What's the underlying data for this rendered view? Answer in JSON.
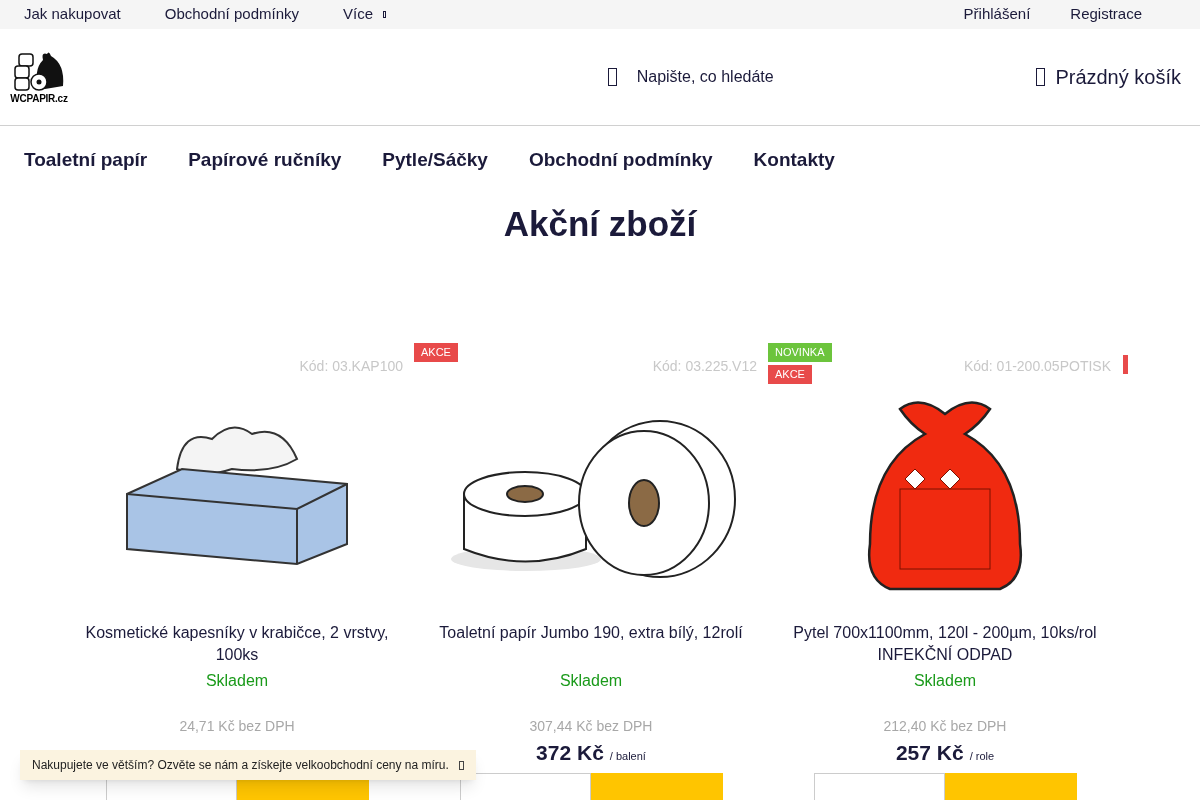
{
  "top_bar": {
    "links": [
      "Jak nakupovat",
      "Obchodní podmínky",
      "Více"
    ],
    "account": [
      "Přihlášení",
      "Registrace"
    ]
  },
  "header": {
    "logo_text": "WCPAPIR.cz",
    "search": {
      "placeholder": "Napište, co hledáte"
    },
    "cart": "Prázdný košík"
  },
  "nav": [
    "Toaletní papír",
    "Papírové ručníky",
    "Pytle/Sáčky",
    "Obchodní podmínky",
    "Kontakty"
  ],
  "heading": "Akční zboží",
  "products": [
    {
      "kind": "tissues",
      "code": "Kód: 03.KAP100",
      "name": "Kosmetické kapesníky v krabičce, 2 vrstvy, 100ks",
      "availability": "Skladem",
      "price_net": "24,71 Kč bez DPH"
    },
    {
      "kind": "rolls",
      "badges": [
        {
          "label": "AKCE",
          "color": "#e84a4a"
        }
      ],
      "code": "Kód: 03.225.V12",
      "name": "Toaletní papír Jumbo 190, extra bílý, 12rolí",
      "availability": "Skladem",
      "price_net": "307,44 Kč bez DPH",
      "price": "372 Kč",
      "unit": "/ balení"
    },
    {
      "kind": "bag",
      "badges": [
        {
          "label": "NOVINKA",
          "color": "#6cc43c"
        },
        {
          "label": "AKCE",
          "color": "#e84a4a"
        }
      ],
      "code": "Kód: 01-200.05POTISK",
      "name": "Pytel 700x1100mm, 120l - 200µm, 10ks/rol INFEKČNÍ ODPAD",
      "availability": "Skladem",
      "price_net": "212,40 Kč bez DPH",
      "price": "257 Kč",
      "unit": "/ role"
    }
  ],
  "promo_banner": "Nakupujete ve větším? Ozvěte se nám a získejte velkoobchodní ceny na míru."
}
